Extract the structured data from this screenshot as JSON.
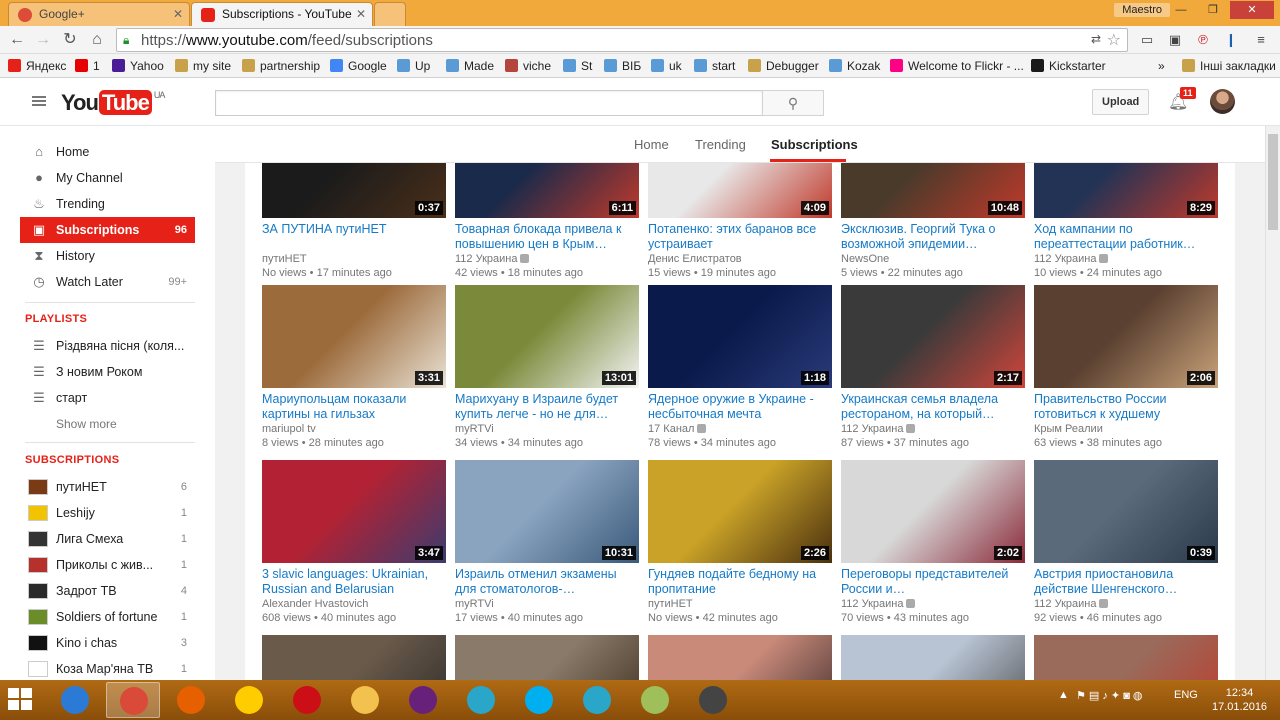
{
  "browser": {
    "tabs": [
      {
        "label": "Google+",
        "color": "#dd4b39"
      },
      {
        "label": "Subscriptions - YouTube",
        "color": "#e62117"
      },
      {
        "label": "",
        "color": "#f6c27a"
      }
    ],
    "user": "Maestro",
    "url_scheme": "https://",
    "url_host": "www.youtube.com",
    "url_path": "/feed/subscriptions",
    "bookmarks": [
      {
        "label": "Яндекс",
        "color": "#e62117"
      },
      {
        "label": "1",
        "color": "#e60000"
      },
      {
        "label": "Yahoo",
        "color": "#4a1d96"
      },
      {
        "label": "my site",
        "color": "#c8a24a"
      },
      {
        "label": "partnership",
        "color": "#c8a24a"
      },
      {
        "label": "Google",
        "color": "#4285f4"
      },
      {
        "label": "Up",
        "color": "#5b9bd5"
      },
      {
        "label": "Made",
        "color": "#5b9bd5"
      },
      {
        "label": "viche",
        "color": "#b5453a"
      },
      {
        "label": "St",
        "color": "#5b9bd5"
      },
      {
        "label": "ВІБ",
        "color": "#5b9bd5"
      },
      {
        "label": "uk",
        "color": "#5b9bd5"
      },
      {
        "label": "start",
        "color": "#5b9bd5"
      },
      {
        "label": "Debugger",
        "color": "#c8a24a"
      },
      {
        "label": "Kozak",
        "color": "#5b9bd5"
      },
      {
        "label": "Welcome to Flickr - ...",
        "color": "#ff0084"
      },
      {
        "label": "Kickstarter",
        "color": "#1a1a1a"
      },
      {
        "label": "»",
        "color": ""
      },
      {
        "label": "Інші закладки",
        "color": "#c8a24a"
      }
    ]
  },
  "header": {
    "logo_you": "You",
    "logo_tube": "Tube",
    "logo_region": "UA",
    "upload_label": "Upload",
    "notifications": "11"
  },
  "sidebar": {
    "main": [
      {
        "label": "Home",
        "icon": "home-icon",
        "glyph": "⌂",
        "count": ""
      },
      {
        "label": "My Channel",
        "icon": "user-icon",
        "glyph": "●",
        "count": ""
      },
      {
        "label": "Trending",
        "icon": "flame-icon",
        "glyph": "♨",
        "count": ""
      },
      {
        "label": "Subscriptions",
        "icon": "subscriptions-icon",
        "glyph": "▣",
        "count": "96"
      },
      {
        "label": "History",
        "icon": "history-icon",
        "glyph": "⧗",
        "count": ""
      },
      {
        "label": "Watch Later",
        "icon": "clock-icon",
        "glyph": "◷",
        "count": "99+"
      }
    ],
    "playlists_heading": "PLAYLISTS",
    "playlists": [
      {
        "label": "Різдвяна пісня (коля..."
      },
      {
        "label": "З новим Роком"
      },
      {
        "label": "старт"
      }
    ],
    "show_more": "Show more",
    "subscriptions_heading": "SUBSCRIPTIONS",
    "subscriptions": [
      {
        "label": "путиНЕТ",
        "count": "6",
        "color": "#7a3b14"
      },
      {
        "label": "Leshijy",
        "count": "1",
        "color": "#f2c300"
      },
      {
        "label": "Лига Смеха",
        "count": "1",
        "color": "#333333"
      },
      {
        "label": "Приколы с жив...",
        "count": "1",
        "color": "#b7312c"
      },
      {
        "label": "Задрот ТВ",
        "count": "4",
        "color": "#2a2a2a"
      },
      {
        "label": "Soldiers of fortune",
        "count": "1",
        "color": "#6a8d2a"
      },
      {
        "label": "Kino i chas",
        "count": "3",
        "color": "#111111"
      },
      {
        "label": "Коза Мар'яна ТВ",
        "count": "1",
        "color": "#ffffff"
      }
    ]
  },
  "nav_tabs": [
    {
      "label": "Home"
    },
    {
      "label": "Trending"
    },
    {
      "label": "Subscriptions"
    }
  ],
  "videos": [
    {
      "title": "ЗА ПУТИНА путиНЕТ",
      "channel": "путиНЕТ",
      "verified": false,
      "views": "No views",
      "ago": "17 minutes ago",
      "duration": "0:37",
      "colors": [
        "#1b1b1b",
        "#4a2f1a"
      ]
    },
    {
      "title": "Товарная блокада привела к повышению цен в Крым…",
      "channel": "112 Украина",
      "verified": true,
      "views": "42 views",
      "ago": "18 minutes ago",
      "duration": "6:11",
      "colors": [
        "#1a2a4a",
        "#c0392b"
      ]
    },
    {
      "title": "Потапенко: этих баранов все устраивает",
      "channel": "Денис Елистратов",
      "verified": false,
      "views": "15 views",
      "ago": "19 minutes ago",
      "duration": "4:09",
      "colors": [
        "#e8e8e8",
        "#c0392b"
      ]
    },
    {
      "title": "Эксклюзив. Георгий Тука о возможной эпидемии…",
      "channel": "NewsOne",
      "verified": false,
      "views": "5 views",
      "ago": "22 minutes ago",
      "duration": "10:48",
      "colors": [
        "#4a3a2a",
        "#c0392b"
      ]
    },
    {
      "title": "Ход кампании по переаттестации работник…",
      "channel": "112 Украина",
      "verified": true,
      "views": "10 views",
      "ago": "24 minutes ago",
      "duration": "8:29",
      "colors": [
        "#223355",
        "#c0392b"
      ]
    },
    {
      "title": "Мариупольцам показали картины на гильзах",
      "channel": "mariupol tv",
      "verified": false,
      "views": "8 views",
      "ago": "28 minutes ago",
      "duration": "3:31",
      "colors": [
        "#9c6b3c",
        "#e9e2d4"
      ]
    },
    {
      "title": "Марихуану в Израиле будет купить легче - но не для…",
      "channel": "myRTVi",
      "verified": false,
      "views": "34 views",
      "ago": "34 minutes ago",
      "duration": "13:01",
      "colors": [
        "#7a8a3a",
        "#f4f4f4"
      ]
    },
    {
      "title": "Ядерное оружие в Украине - несбыточная мечта",
      "channel": "17 Канал",
      "verified": true,
      "views": "78 views",
      "ago": "34 minutes ago",
      "duration": "1:18",
      "colors": [
        "#0a1a4a",
        "#2a3a7a"
      ]
    },
    {
      "title": "Украинская семья владела рестораном, на который…",
      "channel": "112 Украина",
      "verified": true,
      "views": "87 views",
      "ago": "37 minutes ago",
      "duration": "2:17",
      "colors": [
        "#3a3a3a",
        "#d0453a"
      ]
    },
    {
      "title": "Правительство России готовиться к худшему",
      "channel": "Крым Реалии",
      "verified": false,
      "views": "63 views",
      "ago": "38 minutes ago",
      "duration": "2:06",
      "colors": [
        "#5a4030",
        "#c9a27a"
      ]
    },
    {
      "title": "3 slavic languages: Ukrainian, Russian and Belarusian",
      "channel": "Alexander Hvastovich",
      "verified": false,
      "views": "608 views",
      "ago": "40 minutes ago",
      "duration": "3:47",
      "colors": [
        "#b22234",
        "#3c3b6e"
      ]
    },
    {
      "title": "Израиль отменил экзамены для стоматологов-…",
      "channel": "myRTVi",
      "verified": false,
      "views": "17 views",
      "ago": "40 minutes ago",
      "duration": "10:31",
      "colors": [
        "#8aa4c0",
        "#3a5a7a"
      ]
    },
    {
      "title": "Гундяев подайте бедному на пропитание",
      "channel": "путиНЕТ",
      "verified": false,
      "views": "No views",
      "ago": "42 minutes ago",
      "duration": "2:26",
      "colors": [
        "#c9a227",
        "#4a3010"
      ]
    },
    {
      "title": "Переговоры представителей России и…",
      "channel": "112 Украина",
      "verified": true,
      "views": "70 views",
      "ago": "43 minutes ago",
      "duration": "2:02",
      "colors": [
        "#d8d8d8",
        "#8a2a3a"
      ]
    },
    {
      "title": "Австрия приостановила действие Шенгенского…",
      "channel": "112 Украина",
      "verified": true,
      "views": "92 views",
      "ago": "46 minutes ago",
      "duration": "0:39",
      "colors": [
        "#5a6a7a",
        "#2a3a4a"
      ]
    },
    {
      "title": "",
      "channel": "",
      "verified": false,
      "views": "",
      "ago": "",
      "duration": "",
      "colors": [
        "#6a5a4a",
        "#2a2a2a"
      ]
    },
    {
      "title": "",
      "channel": "",
      "verified": false,
      "views": "",
      "ago": "",
      "duration": "",
      "colors": [
        "#8a7a6a",
        "#3a2a1a"
      ]
    },
    {
      "title": "",
      "channel": "",
      "verified": false,
      "views": "",
      "ago": "",
      "duration": "",
      "colors": [
        "#c98a7a",
        "#3a2a2a"
      ]
    },
    {
      "title": "",
      "channel": "",
      "verified": false,
      "views": "",
      "ago": "",
      "duration": "",
      "colors": [
        "#b8c4d4",
        "#4a4a4a"
      ]
    },
    {
      "title": "",
      "channel": "",
      "verified": false,
      "views": "",
      "ago": "",
      "duration": "",
      "colors": [
        "#9a6a5a",
        "#c0392b"
      ]
    }
  ],
  "taskbar": {
    "apps": [
      {
        "name": "ie-icon",
        "color": "#2b7bd6"
      },
      {
        "name": "chrome-icon",
        "color": "#d94a38"
      },
      {
        "name": "firefox-icon",
        "color": "#e66000"
      },
      {
        "name": "yandex-browser-icon",
        "color": "#ffcc00"
      },
      {
        "name": "opera-icon",
        "color": "#cc0f16"
      },
      {
        "name": "file-explorer-icon",
        "color": "#f2c14e"
      },
      {
        "name": "visual-studio-icon",
        "color": "#68217a"
      },
      {
        "name": "app-icon",
        "color": "#2aa6c8"
      },
      {
        "name": "skype-icon",
        "color": "#00aff0"
      },
      {
        "name": "app2-icon",
        "color": "#2aa6c8"
      },
      {
        "name": "notes-icon",
        "color": "#9fbf5a"
      },
      {
        "name": "camera-icon",
        "color": "#444444"
      }
    ],
    "lang": "ENG",
    "time": "12:34",
    "date": "17.01.2016"
  }
}
